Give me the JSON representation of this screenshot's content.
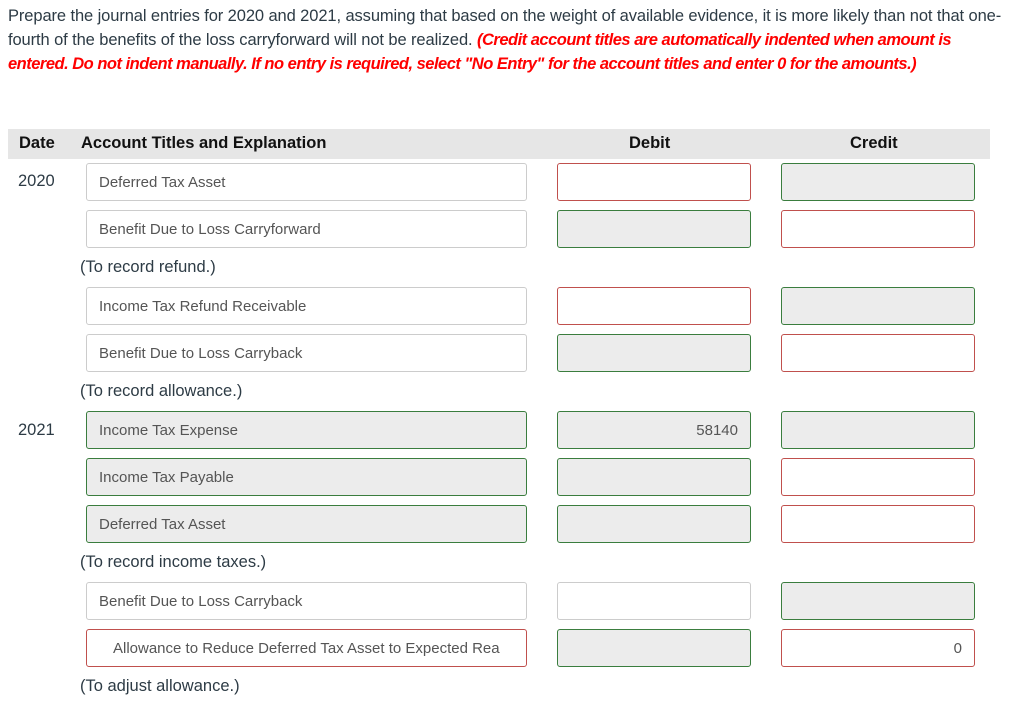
{
  "instructions": {
    "text": "Prepare the journal entries for 2020 and 2021, assuming that based on the weight of available evidence, it is more likely than not that one-fourth of the benefits of the loss carryforward will not be realized.",
    "note": "(Credit account titles are automatically indented when amount is entered. Do not indent manually. If no entry is required, select \"No Entry\" for the account titles and enter 0 for the amounts.)"
  },
  "table": {
    "headers": {
      "date": "Date",
      "account": "Account Titles and Explanation",
      "debit": "Debit",
      "credit": "Credit"
    },
    "rows": [
      {
        "date": "2020",
        "account": "Deferred Tax Asset",
        "debit": "",
        "credit": ""
      },
      {
        "date": "",
        "account": "Benefit Due to Loss Carryforward",
        "debit": "",
        "credit": ""
      },
      {
        "date": "",
        "account": "Income Tax Refund Receivable",
        "debit": "",
        "credit": ""
      },
      {
        "date": "",
        "account": "Benefit Due to Loss Carryback",
        "debit": "",
        "credit": ""
      },
      {
        "date": "2021",
        "account": "Income Tax Expense",
        "debit": "58140",
        "credit": ""
      },
      {
        "date": "",
        "account": "Income Tax Payable",
        "debit": "",
        "credit": ""
      },
      {
        "date": "",
        "account": "Deferred Tax Asset",
        "debit": "",
        "credit": ""
      },
      {
        "date": "",
        "account": "Benefit Due to Loss Carryback",
        "debit": "",
        "credit": ""
      },
      {
        "date": "",
        "account": "Allowance to Reduce Deferred Tax Asset to Expected Rea",
        "debit": "",
        "credit": "0"
      }
    ],
    "notes": [
      "(To record refund.)",
      "(To record allowance.)",
      "(To record income taxes.)",
      "(To adjust allowance.)"
    ]
  },
  "colors": {
    "incorrect_border": "#c0504d",
    "correct_border": "#3a7d3e",
    "instruction_red": "#ff0000"
  }
}
